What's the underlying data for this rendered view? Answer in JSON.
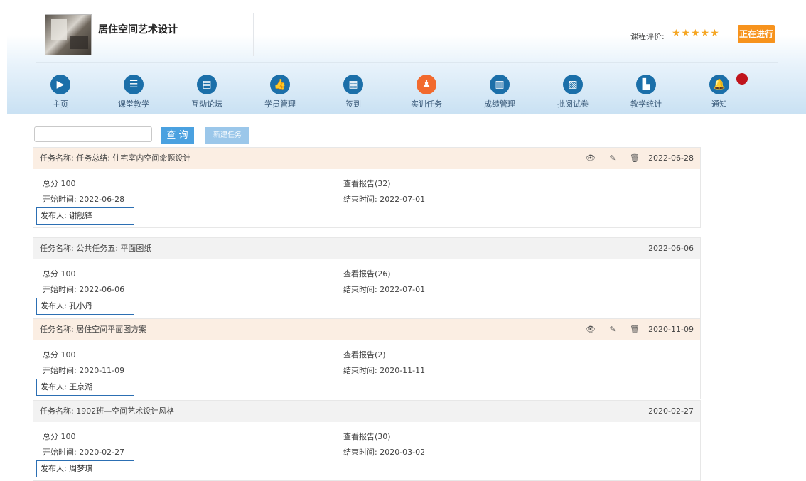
{
  "header": {
    "course_title": "居住空间艺术设计",
    "rating_label": "课程评价:",
    "stars": "★★★★★",
    "status_label": "正在进行"
  },
  "nav": [
    {
      "label": "主页",
      "icon": "home-icon"
    },
    {
      "label": "课堂教学",
      "icon": "list-icon"
    },
    {
      "label": "互动论坛",
      "icon": "forum-icon"
    },
    {
      "label": "学员管理",
      "icon": "thumbs-up-icon"
    },
    {
      "label": "签到",
      "icon": "qrcode-icon"
    },
    {
      "label": "实训任务",
      "icon": "user-task-icon",
      "active": true
    },
    {
      "label": "成绩管理",
      "icon": "grade-icon"
    },
    {
      "label": "批阅试卷",
      "icon": "exam-icon"
    },
    {
      "label": "教学统计",
      "icon": "chart-icon"
    },
    {
      "label": "通知",
      "icon": "bell-icon"
    }
  ],
  "toolbar": {
    "search_value": "",
    "search_label": "查 询",
    "new_task_label": "新建任务"
  },
  "tasks": [
    {
      "name": "任务名称: 任务总结: 住宅室内空间命题设计",
      "date": "2022-06-28",
      "has_actions": true,
      "score": "总分 100",
      "report": "查看报告(32)",
      "start": "开始时间: 2022-06-28",
      "end": "结束时间: 2022-07-01",
      "publisher": "发布人: 谢舰锋"
    },
    {
      "name": "任务名称: 公共任务五: 平面图纸",
      "date": "2022-06-06",
      "has_actions": false,
      "score": "总分 100",
      "report": "查看报告(26)",
      "start": "开始时间: 2022-06-06",
      "end": "结束时间: 2022-07-01",
      "publisher": "发布人: 孔小丹"
    },
    {
      "name": "任务名称: 居住空间平面图方案",
      "date": "2020-11-09",
      "has_actions": true,
      "score": "总分 100",
      "report": "查看报告(2)",
      "start": "开始时间: 2020-11-09",
      "end": "结束时间: 2020-11-11",
      "publisher": "发布人: 王京湖"
    },
    {
      "name": "任务名称: 1902班—空间艺术设计风格",
      "date": "2020-02-27",
      "has_actions": false,
      "score": "总分 100",
      "report": "查看报告(30)",
      "start": "开始时间: 2020-02-27",
      "end": "结束时间: 2020-03-02",
      "publisher": "发布人: 周梦琪"
    }
  ],
  "icons": {
    "view": "👁",
    "edit": "✎",
    "delete": "🗑"
  },
  "colors": {
    "accent": "#f7931d",
    "nav_icon": "#1b6fa9",
    "nav_active": "#f26a2e",
    "search_button": "#4aa1e0",
    "highlight_box": "#2c6fb3"
  }
}
